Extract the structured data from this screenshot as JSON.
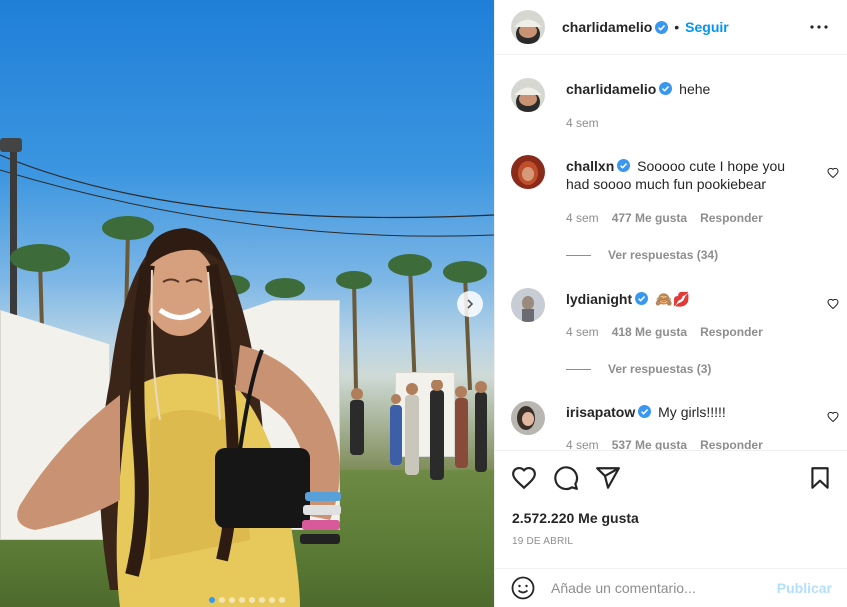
{
  "post": {
    "author": "charlidamelio",
    "follow_label": "Seguir",
    "separator": "•",
    "slide_count": 8,
    "active_slide": 1
  },
  "caption": {
    "user": "charlidamelio",
    "text": "hehe",
    "time": "4 sem"
  },
  "comments": [
    {
      "user": "challxn",
      "text": "Sooooo cute I hope you had soooo much fun pookiebear",
      "time": "4 sem",
      "likes": "477 Me gusta",
      "reply": "Responder",
      "view_replies": "Ver respuestas (34)"
    },
    {
      "user": "lydianight",
      "text": "🙈💋",
      "time": "4 sem",
      "likes": "418 Me gusta",
      "reply": "Responder",
      "view_replies": "Ver respuestas (3)"
    },
    {
      "user": "irisapatow",
      "text": "My girls!!!!!",
      "time": "4 sem",
      "likes": "537 Me gusta",
      "reply": "Responder"
    }
  ],
  "actions": {
    "likes_count": "2.572.220 Me gusta",
    "date": "19 DE ABRIL"
  },
  "comment_box": {
    "placeholder": "Añade un comentario...",
    "publish_label": "Publicar"
  },
  "colors": {
    "accent": "#0095f6",
    "verified": "#3897f0",
    "muted": "#8e8e8e",
    "publish_disabled": "#b2dffc"
  },
  "icons": [
    "verified-icon",
    "more-icon",
    "heart-icon",
    "comment-icon",
    "share-icon",
    "bookmark-icon",
    "emoji-icon",
    "chevron-right-icon"
  ]
}
